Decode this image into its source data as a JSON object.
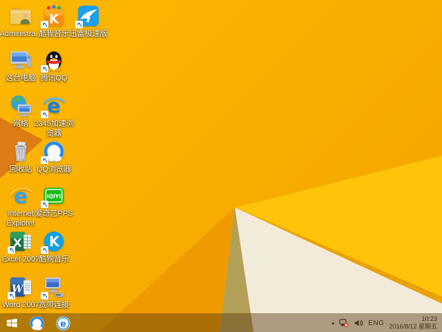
{
  "desktop": {
    "icons": [
      {
        "label": "Administra...",
        "shortcut": false
      },
      {
        "label": "酷我音乐",
        "shortcut": true,
        "glyph": "K"
      },
      {
        "label": "迅雷极速版",
        "shortcut": true
      },
      {
        "label": "这台电脑",
        "shortcut": false
      },
      {
        "label": "腾讯QQ",
        "shortcut": true
      },
      {
        "label": "网络",
        "shortcut": false
      },
      {
        "label": "2345加速浏览器",
        "shortcut": true,
        "glyph": "e"
      },
      {
        "label": "回收站",
        "shortcut": false
      },
      {
        "label": "QQ浏览器",
        "shortcut": true
      },
      {
        "label": "Internet Explorer",
        "shortcut": false,
        "glyph": "e"
      },
      {
        "label": "爱奇艺PPS",
        "shortcut": true,
        "glyph": "iQIYI"
      },
      {
        "label": "Excel 2007",
        "shortcut": true,
        "glyph": "X"
      },
      {
        "label": "酷狗音乐",
        "shortcut": true,
        "glyph": "K"
      },
      {
        "label": "Word 2007",
        "shortcut": true,
        "glyph": "W"
      },
      {
        "label": "宽带连接",
        "shortcut": true
      }
    ]
  },
  "taskbar": {
    "tray": {
      "language": "ENG",
      "time": "10:23",
      "date": "2016/8/12 星期五"
    }
  },
  "colors": {
    "wallpaper_main": "#F8AC00",
    "wallpaper_bright_facet": "#FFC30A",
    "wallpaper_cream_facet": "#F3EBDA",
    "wallpaper_olive_facet": "#B2A058",
    "wallpaper_red_facet": "#DD7B15",
    "taskbar_tint": "rgba(86,55,18,0.44)",
    "tray_text": "#3D2F12",
    "icon_label_text": "#FFFFFF"
  }
}
